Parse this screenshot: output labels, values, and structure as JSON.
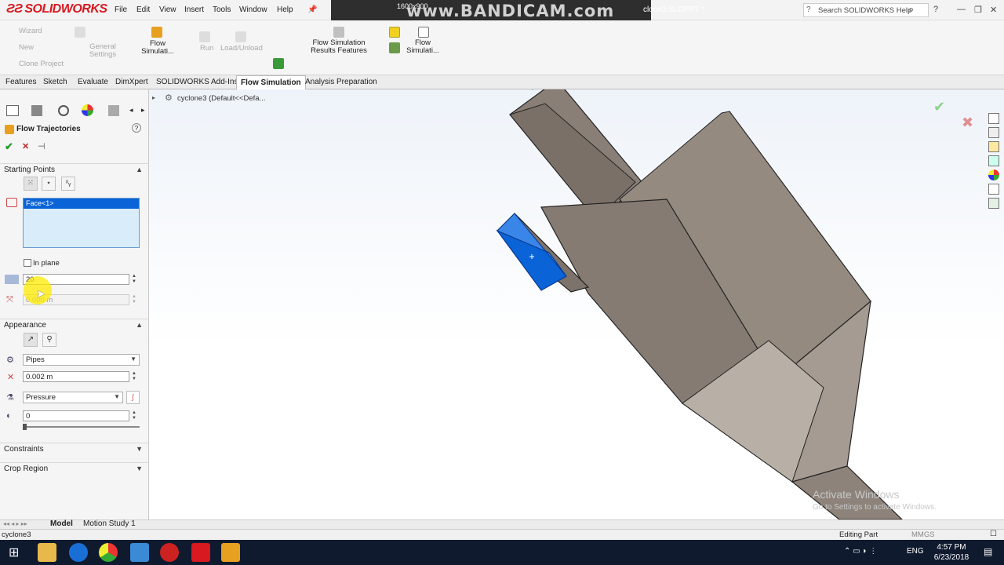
{
  "app": {
    "logo": "SOLIDWORKS",
    "menu": [
      "File",
      "Edit",
      "View",
      "Insert",
      "Tools",
      "Window",
      "Help"
    ],
    "doc_title": "clone3.SLDPRT *",
    "search_placeholder": "Search SOLIDWORKS Help",
    "recorder_watermark": "www.BANDICAM.com",
    "recorder_resolution": "1600x900"
  },
  "command_manager": {
    "small_left": [
      "Wizard",
      "New",
      "Clone Project"
    ],
    "general_settings": "General Settings",
    "flow_sim": "Flow Simulati...",
    "run": "Run",
    "load_unload": "Load/Unload",
    "results_features": "Flow Simulation Results Features",
    "flow_sim_2": "Flow Simulati..."
  },
  "tabs": [
    "Features",
    "Sketch",
    "Evaluate",
    "DimXpert",
    "SOLIDWORKS Add-Ins",
    "Flow Simulation",
    "Analysis Preparation"
  ],
  "active_tab": "Flow Simulation",
  "panel": {
    "title": "Flow Trajectories",
    "starting_points": {
      "header": "Starting Points",
      "selection": "Face<1>",
      "in_plane_label": "In plane",
      "count_value": "20",
      "offset_value": "0.000 m"
    },
    "appearance": {
      "header": "Appearance",
      "draw_as": "Pipes",
      "width_value": "0.002 m",
      "color_by": "Pressure",
      "opacity_value": "0"
    },
    "constraints_header": "Constraints",
    "crop_region_header": "Crop Region"
  },
  "viewport": {
    "breadcrumb": "cyclone3 (Default<<Defa...",
    "activate_title": "Activate Windows",
    "activate_sub": "Go to Settings to activate Windows."
  },
  "bottom_tabs": [
    "Model",
    "Motion Study 1"
  ],
  "status": {
    "left": "cyclone3",
    "editing": "Editing Part",
    "units": "MMGS"
  },
  "taskbar": {
    "time": "4:57 PM",
    "date": "6/23/2018",
    "lang": "ENG"
  },
  "colors": {
    "selection_blue": "#0a64d8",
    "model_grey": "#8a7f76",
    "logo_red": "#d71920"
  }
}
